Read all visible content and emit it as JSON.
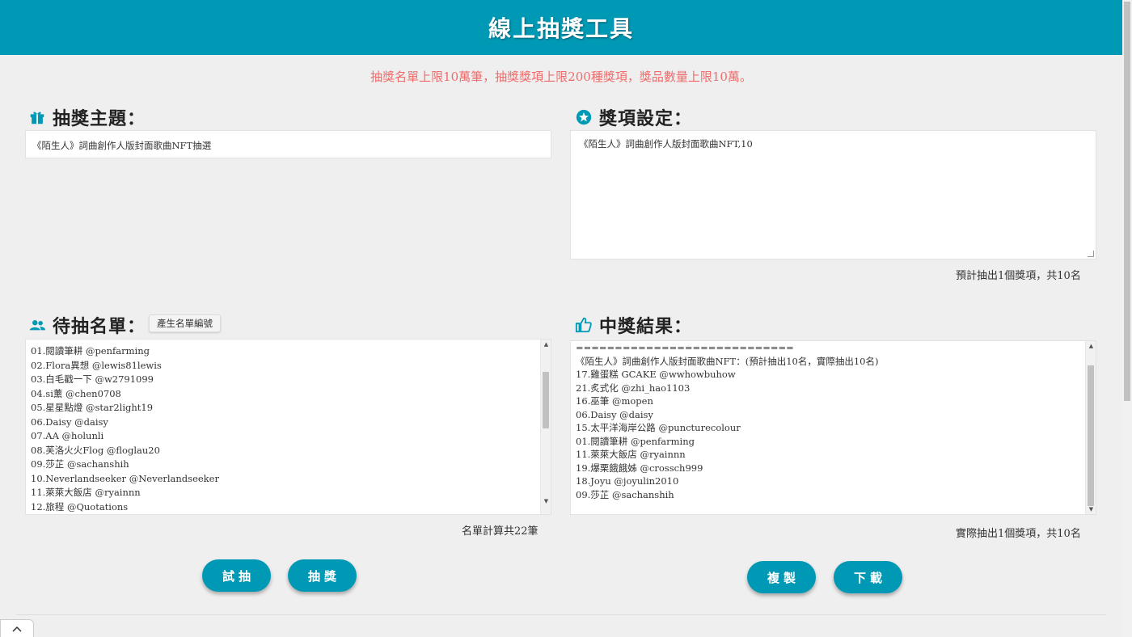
{
  "header": {
    "title": "線上抽獎工具"
  },
  "notice": "抽獎名單上限10萬筆，抽獎獎項上限200種獎項，獎品數量上限10萬。",
  "topic": {
    "title": "抽獎主題：",
    "icon": "gift-icon",
    "value": "《陌生人》詞曲創作人版封面歌曲NFT抽選"
  },
  "prizes": {
    "title": "獎項設定：",
    "icon": "star-circle-icon",
    "value": "《陌生人》詞曲創作人版封面歌曲NFT,10",
    "summary": "預計抽出1個獎項，共10名"
  },
  "candidates": {
    "title": "待抽名單：",
    "icon": "people-icon",
    "number_button": "產生名單編號",
    "lines": [
      "01.閱讀筆耕 @penfarming",
      "02.Flora異想 @lewis81lewis",
      "03.白毛戳一下 @w2791099",
      "04.si薰 @chen0708",
      "05.星星點燈 @star2light19",
      "06.Daisy @daisy",
      "07.AA @holunli",
      "08.芙洛火火Flog @floglau20",
      "09.莎芷 @sachanshih",
      "10.Neverlandseeker @Neverlandseeker",
      "11.萊萊大飯店 @ryainnn",
      "12.旅程 @Quotations"
    ],
    "count": "名單計算共22筆"
  },
  "results": {
    "title": "中獎結果：",
    "icon": "thumbs-up-icon",
    "lines": [
      "============================",
      "《陌生人》詞曲創作人版封面歌曲NFT：(預計抽出10名，實際抽出10名)",
      "17.雞蛋糕 GCAKE @wwhowbuhow",
      "21.炙式化 @zhi_hao1103",
      "16.巫筆 @mopen",
      "06.Daisy @daisy",
      "15.太平洋海岸公路 @puncturecolour",
      "01.閱讀筆耕 @penfarming",
      "11.萊萊大飯店 @ryainnn",
      "19.爆栗餓餓姊 @crossch999",
      "18.Joyu @joyulin2010",
      "09.莎芷 @sachanshih"
    ],
    "summary": "實際抽出1個獎項，共10名"
  },
  "buttons": {
    "trial": "試抽",
    "draw": "抽獎",
    "copy": "複製",
    "download": "下載"
  },
  "colors": {
    "accent": "#0099b5",
    "notice": "#f06b6b",
    "background": "#efefef"
  }
}
